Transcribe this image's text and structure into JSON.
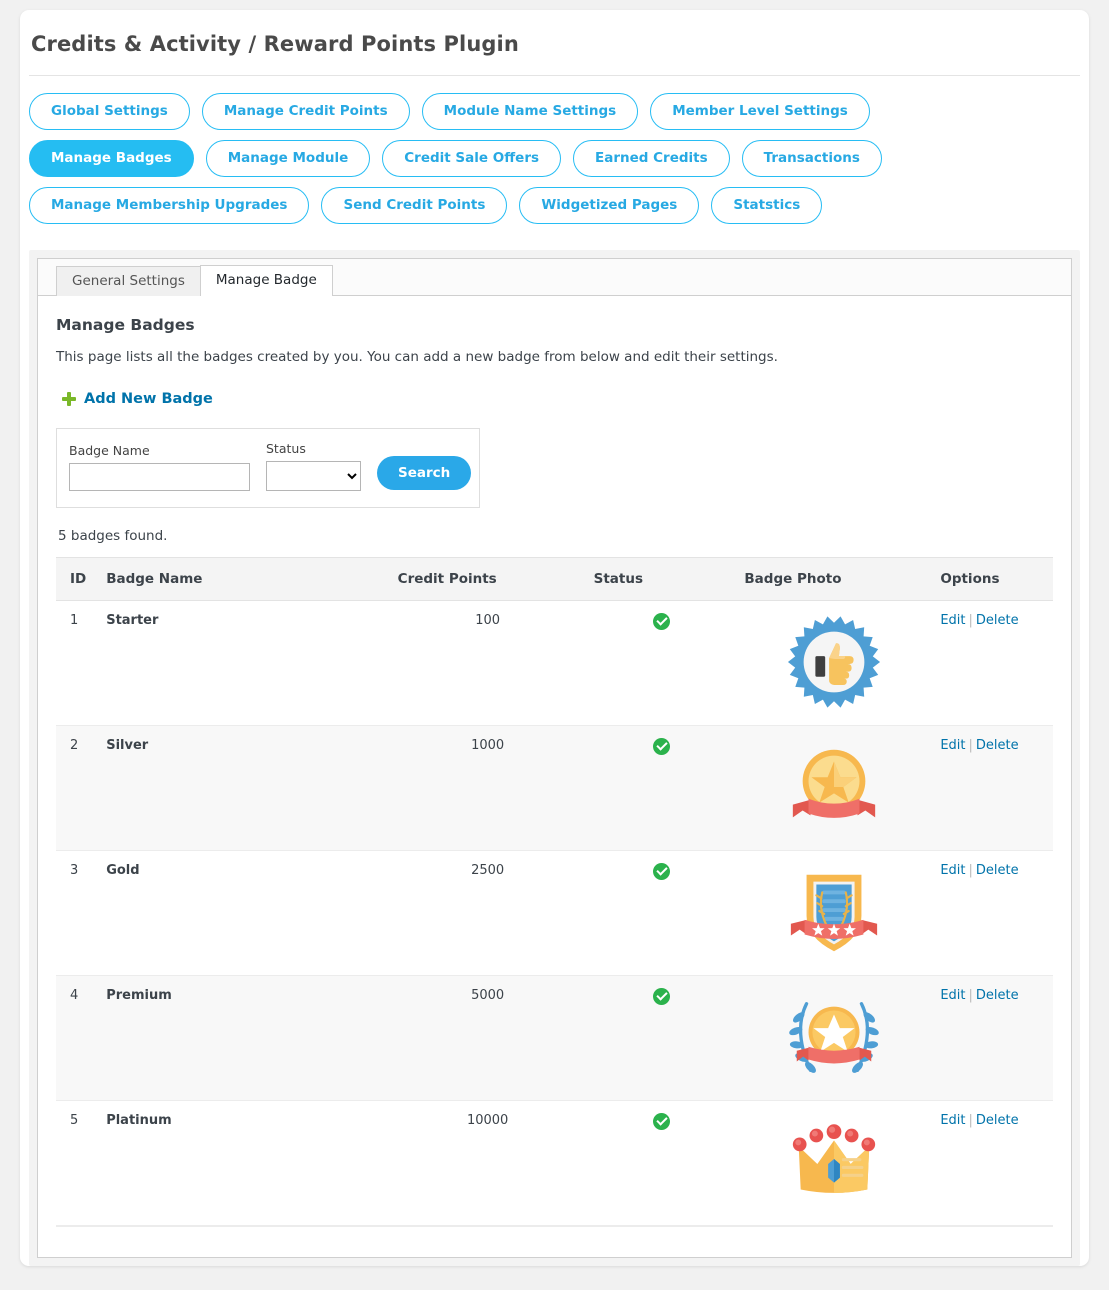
{
  "header": {
    "title": "Credits & Activity / Reward Points Plugin"
  },
  "nav": {
    "pills": [
      {
        "label": "Global Settings",
        "active": false
      },
      {
        "label": "Manage Credit Points",
        "active": false
      },
      {
        "label": "Module Name Settings",
        "active": false
      },
      {
        "label": "Member Level Settings",
        "active": false
      },
      {
        "label": "Manage Badges",
        "active": true
      },
      {
        "label": "Manage Module",
        "active": false
      },
      {
        "label": "Credit Sale Offers",
        "active": false
      },
      {
        "label": "Earned Credits",
        "active": false
      },
      {
        "label": "Transactions",
        "active": false
      },
      {
        "label": "Manage Membership Upgrades",
        "active": false
      },
      {
        "label": "Send Credit Points",
        "active": false
      },
      {
        "label": "Widgetized Pages",
        "active": false
      },
      {
        "label": "Statstics",
        "active": false
      }
    ]
  },
  "tabs": [
    {
      "label": "General Settings",
      "active": false
    },
    {
      "label": "Manage Badge",
      "active": true
    }
  ],
  "main": {
    "section_title": "Manage Badges",
    "section_desc": "This page lists all the badges created by you. You can add a new badge from below and edit their settings.",
    "add_new_label": "Add New Badge",
    "search": {
      "badge_name_label": "Badge Name",
      "badge_name_value": "",
      "badge_name_placeholder": "",
      "status_label": "Status",
      "status_value": "",
      "status_options": [
        ""
      ],
      "button_label": "Search"
    },
    "results_count_text": "5 badges found.",
    "table": {
      "columns": [
        "ID",
        "Badge Name",
        "Credit Points",
        "Status",
        "Badge Photo",
        "Options"
      ],
      "rows": [
        {
          "id": "1",
          "name": "Starter",
          "points": "100",
          "status": "active",
          "photo": "thumbs-up-rosette-badge",
          "edit": "Edit",
          "delete": "Delete"
        },
        {
          "id": "2",
          "name": "Silver",
          "points": "1000",
          "status": "active",
          "photo": "star-medal-ribbon-badge",
          "edit": "Edit",
          "delete": "Delete"
        },
        {
          "id": "3",
          "name": "Gold",
          "points": "2500",
          "status": "active",
          "photo": "shield-stars-ribbon-badge",
          "edit": "Edit",
          "delete": "Delete"
        },
        {
          "id": "4",
          "name": "Premium",
          "points": "5000",
          "status": "active",
          "photo": "laurel-star-medal-badge",
          "edit": "Edit",
          "delete": "Delete"
        },
        {
          "id": "5",
          "name": "Platinum",
          "points": "10000",
          "status": "active",
          "photo": "crown-badge",
          "edit": "Edit",
          "delete": "Delete"
        }
      ]
    }
  },
  "colors": {
    "accent": "#25bdf2",
    "pill_border": "#27bdf4",
    "link": "#0073aa",
    "status_green": "#2bb24c",
    "plus_green": "#7ab829",
    "page_bg": "#f1f1f1"
  }
}
